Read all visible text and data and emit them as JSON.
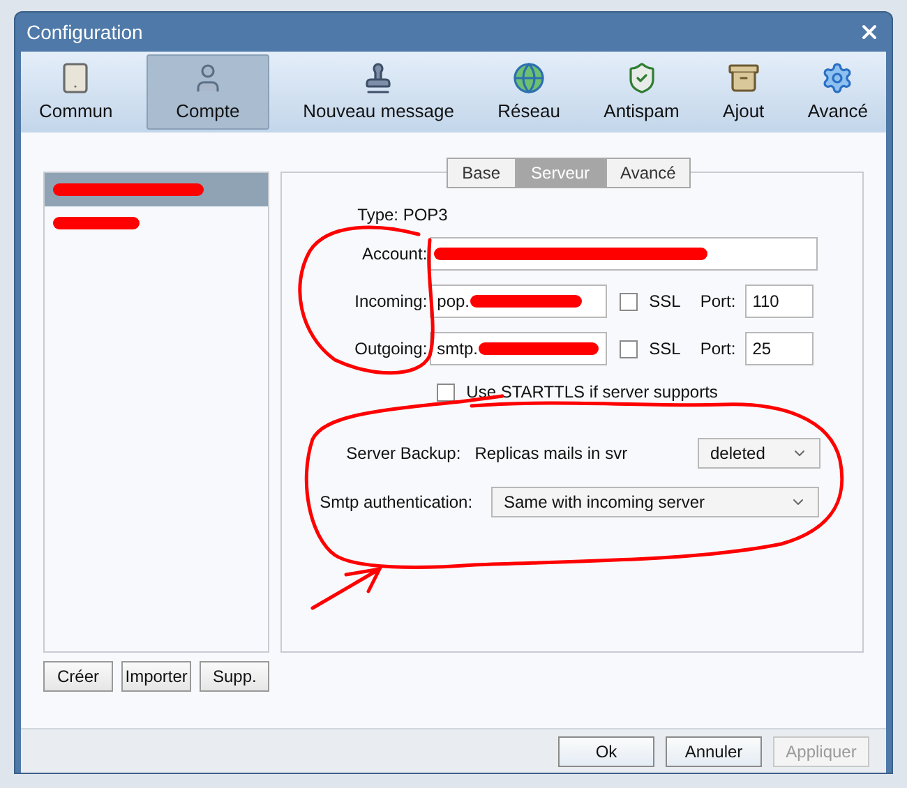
{
  "window": {
    "title": "Configuration"
  },
  "toolbar": [
    {
      "label": "Commun",
      "selected": false
    },
    {
      "label": "Compte",
      "selected": true
    },
    {
      "label": "Nouveau message",
      "selected": false
    },
    {
      "label": "Réseau",
      "selected": false
    },
    {
      "label": "Antispam",
      "selected": false
    },
    {
      "label": "Ajout",
      "selected": false
    },
    {
      "label": "Avancé",
      "selected": false
    }
  ],
  "accounts": [
    {
      "selected": true
    },
    {
      "selected": false
    }
  ],
  "account_buttons": [
    "Créer",
    "Importer",
    "Supp."
  ],
  "tabs": [
    {
      "label": "Base",
      "selected": false
    },
    {
      "label": "Serveur",
      "selected": true
    },
    {
      "label": "Avancé",
      "selected": false
    }
  ],
  "type": "Type: POP3",
  "account": {
    "label": "Account:"
  },
  "servers": [
    {
      "label": "Incoming:",
      "value": "pop.",
      "ssl": {
        "label": "SSL",
        "checked": false
      },
      "port_label": "Port:",
      "port": "110"
    },
    {
      "label": "Outgoing:",
      "value": "smtp.",
      "ssl": {
        "label": "SSL",
        "checked": false
      },
      "port_label": "Port:",
      "port": "25"
    }
  ],
  "starttls": {
    "label": "Use STARTTLS if server supports",
    "checked": false
  },
  "server_backup": {
    "label": "Server Backup:",
    "description": "Replicas mails in svr",
    "value": "deleted"
  },
  "smtp_auth": {
    "label": "Smtp authentication:",
    "value": "Same with incoming server"
  },
  "footer_buttons": [
    {
      "label": "Ok",
      "disabled": false
    },
    {
      "label": "Annuler",
      "disabled": false
    },
    {
      "label": "Appliquer",
      "disabled": true
    }
  ]
}
